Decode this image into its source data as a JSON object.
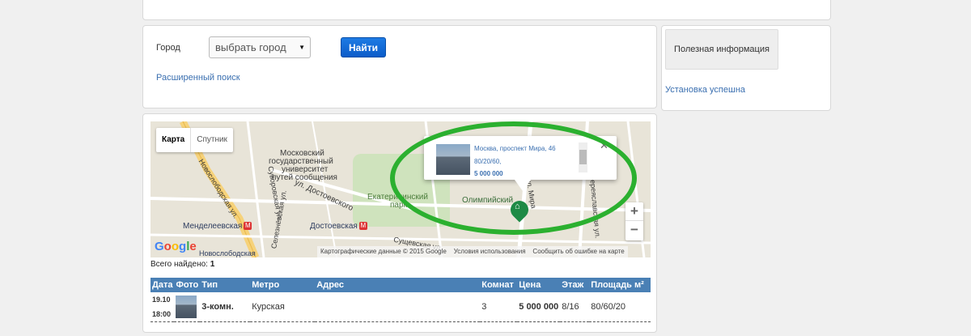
{
  "search": {
    "city_label": "Город",
    "city_select_value": "выбрать город",
    "find_button": "Найти",
    "advanced_link": "Расширенный поиск"
  },
  "info": {
    "box_label": "Полезная информация",
    "status_text": "Установка успешна"
  },
  "map": {
    "map_button": "Карта",
    "satellite_button": "Спутник",
    "labels": [
      "Московский",
      "государственный",
      "университет",
      "путей сообщения",
      "Екатерининский",
      "парк",
      "ул. Достоевского",
      "Олимпийский",
      "Менделеевская",
      "Достоевская",
      "Новослободская ул.",
      "Суворовская ул.",
      "Селезнёвская ул.",
      "ул. Мира",
      "Переяславская ул.",
      "Сущевская ул.",
      "Новослободская"
    ],
    "copyright_data": "Картографические данные © 2015 Google",
    "copyright_terms": "Условия использования",
    "copyright_report": "Сообщить об ошибке на карте",
    "google_logo": "Google",
    "zoom_in": "+",
    "zoom_out": "−",
    "popup": {
      "address": "Москва, проспект Мира, 46",
      "area": "80/20/60,",
      "price": "5 000 000",
      "close": "✕"
    }
  },
  "results": {
    "found_label": "Всего найдено:",
    "found_count": "1",
    "columns": [
      "Дата",
      "Фото",
      "Тип",
      "Метро",
      "Адрес",
      "Комнат",
      "Цена",
      "Этаж",
      "Площадь м²"
    ],
    "rows": [
      {
        "date_day": "19.10",
        "date_time": "18:00",
        "type": "3-комн.",
        "metro": "Курская",
        "address": "",
        "rooms": "3",
        "price": "5 000 000",
        "floor": "8/16",
        "area": "80/60/20"
      }
    ]
  },
  "colors": {
    "header_blue": "#4a80b5",
    "button_blue": "#1e7be4",
    "link_blue": "#3a6fb0",
    "annotation_green": "#2bb02f",
    "pin_green": "#1d8a45"
  }
}
